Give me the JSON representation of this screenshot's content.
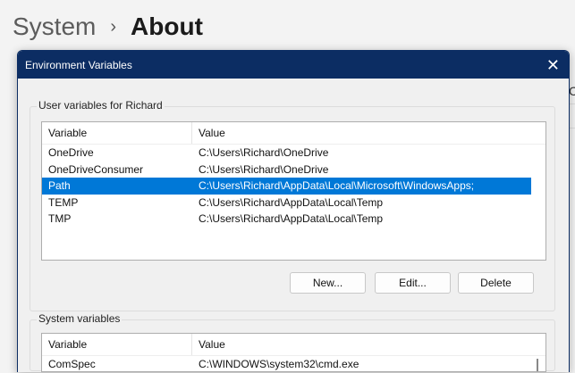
{
  "breadcrumb": {
    "parent": "System",
    "separator": "›",
    "current": "About"
  },
  "background_fragment": "C",
  "dialog": {
    "title": "Environment Variables",
    "user_group": {
      "label": "User variables for Richard",
      "columns": [
        "Variable",
        "Value"
      ],
      "rows": [
        {
          "variable": "OneDrive",
          "value": "C:\\Users\\Richard\\OneDrive"
        },
        {
          "variable": "OneDriveConsumer",
          "value": "C:\\Users\\Richard\\OneDrive"
        },
        {
          "variable": "Path",
          "value": "C:\\Users\\Richard\\AppData\\Local\\Microsoft\\WindowsApps;",
          "selected": true
        },
        {
          "variable": "TEMP",
          "value": "C:\\Users\\Richard\\AppData\\Local\\Temp"
        },
        {
          "variable": "TMP",
          "value": "C:\\Users\\Richard\\AppData\\Local\\Temp"
        }
      ],
      "buttons": {
        "new": "New...",
        "edit": "Edit...",
        "delete": "Delete"
      }
    },
    "system_group": {
      "label": "System variables",
      "columns": [
        "Variable",
        "Value"
      ],
      "rows": [
        {
          "variable": "ComSpec",
          "value": "C:\\WINDOWS\\system32\\cmd.exe"
        }
      ]
    }
  }
}
